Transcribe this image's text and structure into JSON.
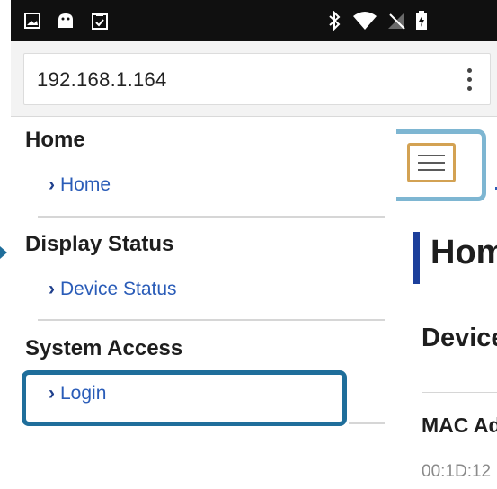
{
  "browser": {
    "url": "192.168.1.164",
    "menu_icon": "kebab-menu-icon"
  },
  "status_bar": {
    "left_icons": [
      "image-icon",
      "android-icon",
      "clipboard-icon"
    ],
    "right_icons": [
      "bluetooth-icon",
      "wifi-icon",
      "signal-icon",
      "battery-icon"
    ]
  },
  "sidebar": {
    "sections": [
      {
        "title": "Home",
        "link": "Home"
      },
      {
        "title": "Display Status",
        "link": "Device Status"
      },
      {
        "title": "System Access",
        "link": "Login"
      }
    ],
    "link_chevron": "›"
  },
  "content": {
    "menu_button_icon": "hamburger-icon",
    "heading": "Hom",
    "subheading": "Device",
    "mac_label": "MAC Ad",
    "mac_value": "00:1D:12"
  },
  "colors": {
    "link": "#2a5cb8",
    "highlight": "#1f6e9b",
    "menu_highlight": "#7eb6d2",
    "menu_button_border": "#d3a253"
  }
}
